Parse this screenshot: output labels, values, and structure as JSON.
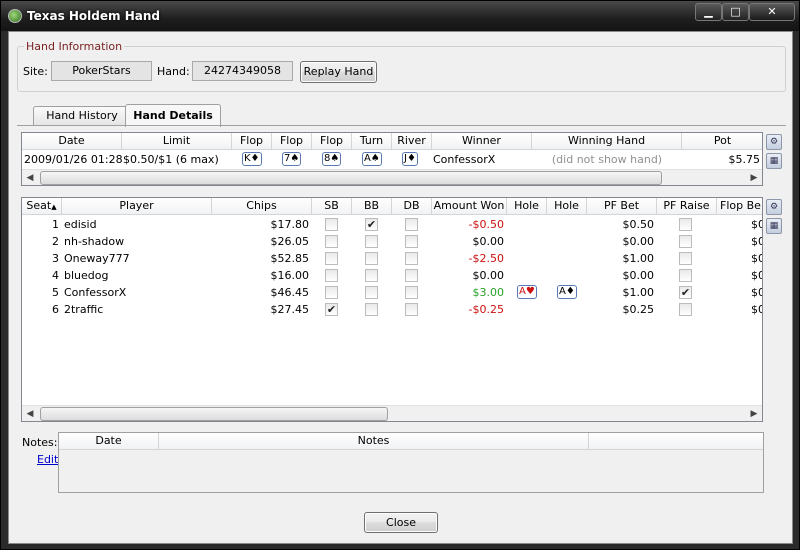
{
  "window": {
    "title": "Texas Holdem Hand",
    "controls": {
      "minimize": "▁",
      "maximize": "□",
      "close": "✕"
    }
  },
  "hand_info": {
    "legend": "Hand Information",
    "site_label": "Site:",
    "site_value": "PokerStars",
    "hand_label": "Hand:",
    "hand_value": "24274349058",
    "replay_button": "Replay Hand"
  },
  "tabs": [
    {
      "label": "Hand History",
      "active": false
    },
    {
      "label": "Hand Details",
      "active": true
    }
  ],
  "summary": {
    "headers": [
      "Date",
      "Limit",
      "Flop",
      "Flop",
      "Flop",
      "Turn",
      "River",
      "Winner",
      "Winning Hand",
      "Pot"
    ],
    "row": {
      "date": "2009/01/26 01:28",
      "limit": "$0.50/$1 (6 max)",
      "flop1": "K♦",
      "flop2": "7♠",
      "flop3": "8♠",
      "turn": "A♠",
      "river": "J♦",
      "winner": "ConfessorX",
      "winning_hand": "(did not show hand)",
      "pot": "$5.75"
    }
  },
  "players": {
    "headers": [
      "Seat",
      "Player",
      "Chips",
      "SB",
      "BB",
      "DB",
      "Amount Won",
      "Hole",
      "Hole",
      "PF Bet",
      "PF Raise",
      "Flop Be"
    ],
    "sort_indicator": "▲",
    "rows": [
      {
        "seat": "1",
        "player": "edisid",
        "chips": "$17.80",
        "sb": false,
        "bb": true,
        "db": false,
        "won": "-$0.50",
        "won_color": "red",
        "hole1": "",
        "hole2": "",
        "pf_bet": "$0.50",
        "pf_raise": false,
        "flop_bet": "$0"
      },
      {
        "seat": "2",
        "player": "nh-shadow",
        "chips": "$26.05",
        "sb": false,
        "bb": false,
        "db": false,
        "won": "$0.00",
        "won_color": "black",
        "hole1": "",
        "hole2": "",
        "pf_bet": "$0.00",
        "pf_raise": false,
        "flop_bet": "$0"
      },
      {
        "seat": "3",
        "player": "Oneway777",
        "chips": "$52.85",
        "sb": false,
        "bb": false,
        "db": false,
        "won": "-$2.50",
        "won_color": "red",
        "hole1": "",
        "hole2": "",
        "pf_bet": "$1.00",
        "pf_raise": false,
        "flop_bet": "$0"
      },
      {
        "seat": "4",
        "player": "bluedog",
        "chips": "$16.00",
        "sb": false,
        "bb": false,
        "db": false,
        "won": "$0.00",
        "won_color": "black",
        "hole1": "",
        "hole2": "",
        "pf_bet": "$0.00",
        "pf_raise": false,
        "flop_bet": "$0"
      },
      {
        "seat": "5",
        "player": "ConfessorX",
        "chips": "$46.45",
        "sb": false,
        "bb": false,
        "db": false,
        "won": "$3.00",
        "won_color": "green",
        "hole1": "A♥",
        "hole2": "A♦",
        "pf_bet": "$1.00",
        "pf_raise": true,
        "flop_bet": "$0"
      },
      {
        "seat": "6",
        "player": "2traffic",
        "chips": "$27.45",
        "sb": true,
        "bb": false,
        "db": false,
        "won": "-$0.25",
        "won_color": "red",
        "hole1": "",
        "hole2": "",
        "pf_bet": "$0.25",
        "pf_raise": false,
        "flop_bet": "$0"
      }
    ]
  },
  "notes": {
    "label": "Notes:",
    "edit_link": "Edit",
    "headers": [
      "Date",
      "Notes"
    ]
  },
  "close_button": "Close",
  "colors": {
    "negative": "#cc1111",
    "positive": "#2aa32a",
    "legend": "#7a2323",
    "link": "#0000cc"
  }
}
